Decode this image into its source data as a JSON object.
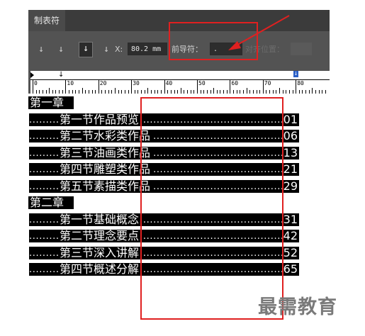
{
  "panel": {
    "tab_label": "制表符",
    "toolbar": {
      "align_left_icon": "↓",
      "align_center_icon": "↓",
      "align_right_icon": "↓",
      "align_decimal_icon": "↓",
      "x_label": "X:",
      "x_value": "80.2 mm",
      "leader_label": "前导符：",
      "leader_value": ".",
      "align_on_label": "对齐位置："
    },
    "ruler": {
      "numbers": [
        "0",
        "10",
        "20",
        "30",
        "40",
        "50",
        "60",
        "70",
        "80"
      ],
      "tabstop_marker": "↓",
      "right_tab_marker": "↓"
    }
  },
  "toc": {
    "chapters": [
      {
        "title": "第一章",
        "sections": [
          {
            "title": "第一节作品预览",
            "page": "01"
          },
          {
            "title": "第二节水彩类作品",
            "page": "06"
          },
          {
            "title": "第三节油画类作品",
            "page": "13"
          },
          {
            "title": "第四节雕塑类作品",
            "page": "21"
          },
          {
            "title": "第五节素描类作品",
            "page": "29"
          }
        ]
      },
      {
        "title": "第二章",
        "sections": [
          {
            "title": "第一节基础概念",
            "page": "31"
          },
          {
            "title": "第二节理念要点",
            "page": "42"
          },
          {
            "title": "第三节深入讲解",
            "page": "52"
          },
          {
            "title": "第四节概述分解",
            "page": "65"
          }
        ]
      }
    ],
    "leader_text": "..................................................................................................."
  },
  "watermark": "最需教育",
  "colors": {
    "panel_bg": "#535353",
    "annotation_red": "#e02020",
    "tab_marker_blue": "#2a5fc7"
  }
}
